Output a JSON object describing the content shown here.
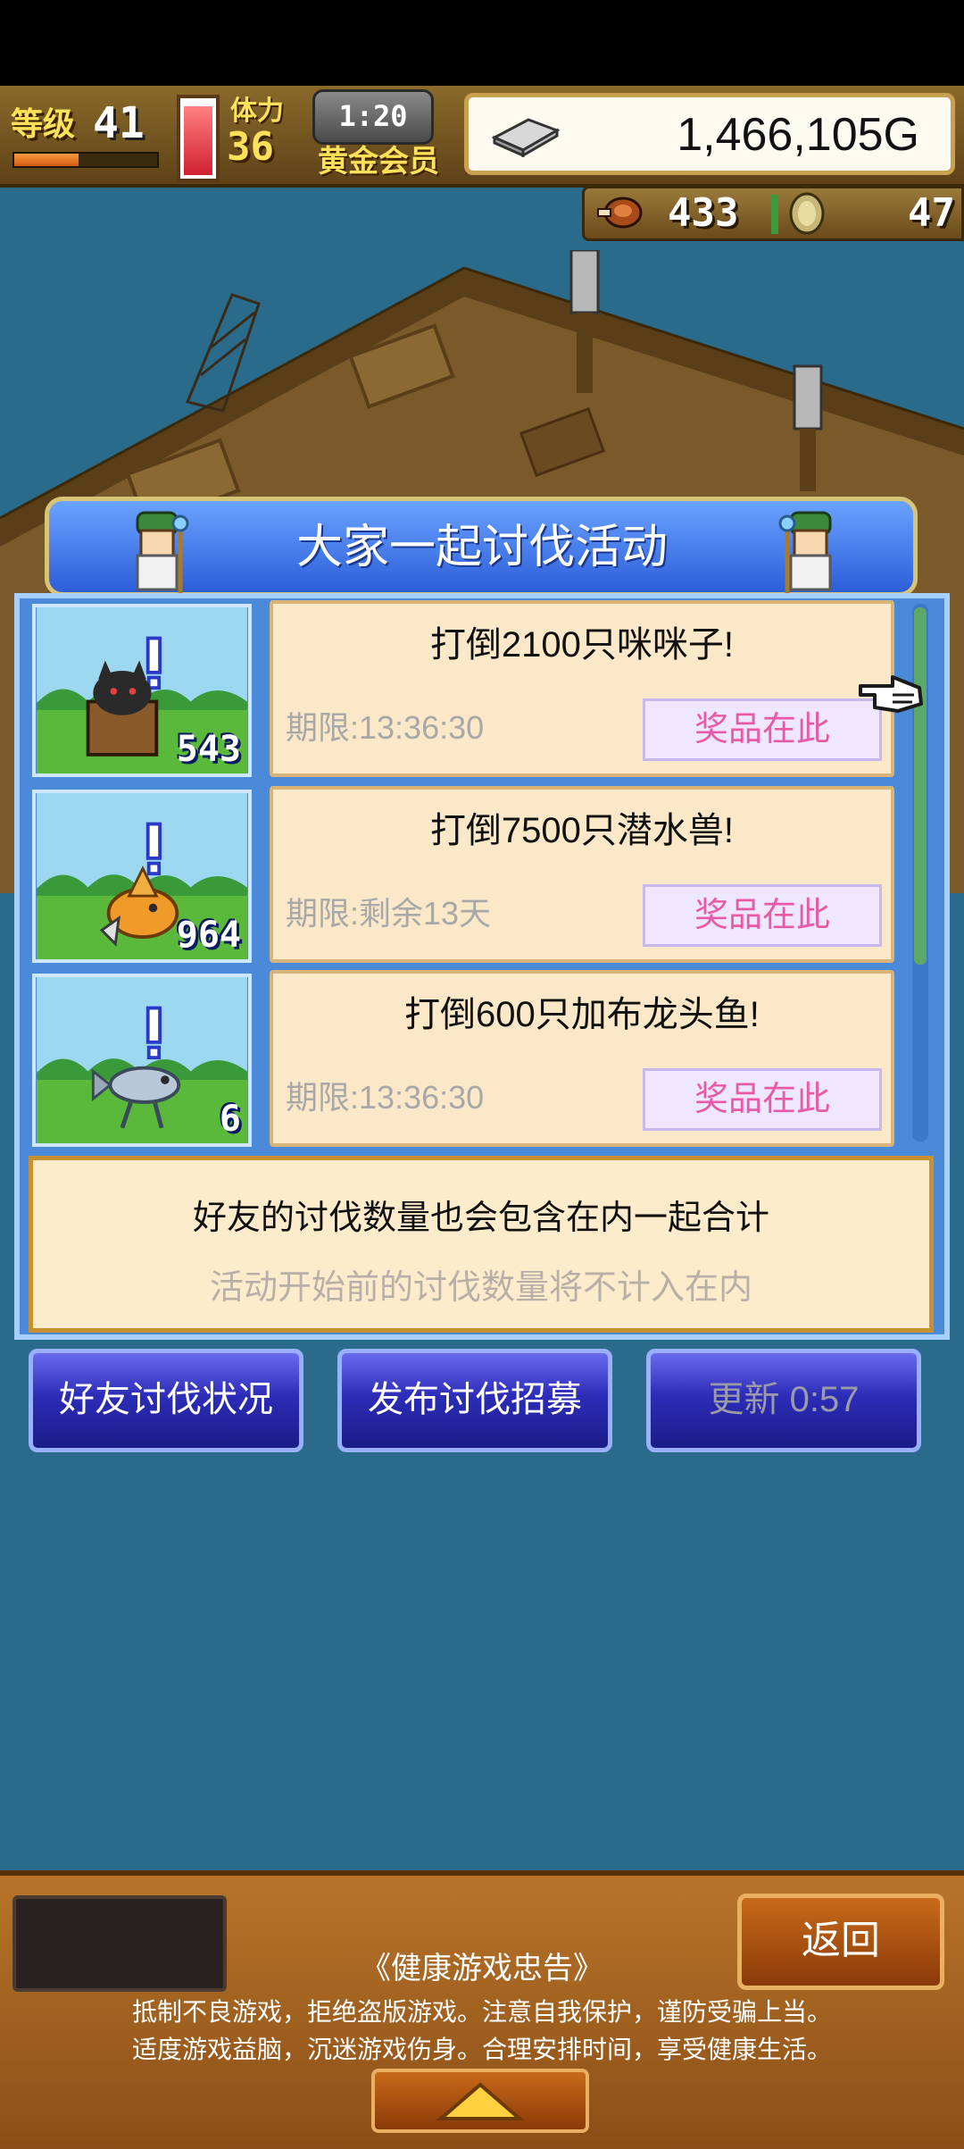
{
  "hud": {
    "level_label": "等级",
    "level": "41",
    "level_progress": 0.45,
    "stamina_label": "体力",
    "stamina": "36",
    "stamina_gauge_level": 0.95,
    "timer": "1:20",
    "membership": "黄金会员",
    "money": "1,466,105G",
    "meat_count": "433",
    "coin_count": "47"
  },
  "dialog": {
    "title": "大家一起讨伐活动",
    "quests": [
      {
        "title": "打倒2100只咪咪子!",
        "deadline": "期限:13:36:30",
        "count": "543",
        "reward_label": "奖品在此",
        "monster_icon": "cat-chest-monster-icon"
      },
      {
        "title": "打倒7500只潜水兽!",
        "deadline": "期限:剩余13天",
        "count": "964",
        "reward_label": "奖品在此",
        "monster_icon": "diving-beast-icon"
      },
      {
        "title": "打倒600只加布龙头鱼!",
        "deadline": "期限:13:36:30",
        "count": "6",
        "reward_label": "奖品在此",
        "monster_icon": "fish-monster-icon"
      }
    ],
    "info_line1": "好友的讨伐数量也会包含在内一起合计",
    "info_line2": "活动开始前的讨伐数量将不计入在内"
  },
  "buttons": {
    "friends_status": "好友讨伐状况",
    "post_recruit": "发布讨伐招募",
    "refresh": "更新 0:57"
  },
  "bottom": {
    "back": "返回",
    "notice_title": "《健康游戏忠告》",
    "notice_line1": "抵制不良游戏，拒绝盗版游戏。注意自我保护，谨防受骗上当。",
    "notice_line2": "适度游戏益脑，沉迷游戏伤身。合理安排时间，享受健康生活。"
  },
  "colors": {
    "dialog_blue": "#4a8ad8",
    "reward_text": "#e85aa8",
    "button_blue": "#2c2cb8",
    "panel_brown": "#8a4e16"
  }
}
